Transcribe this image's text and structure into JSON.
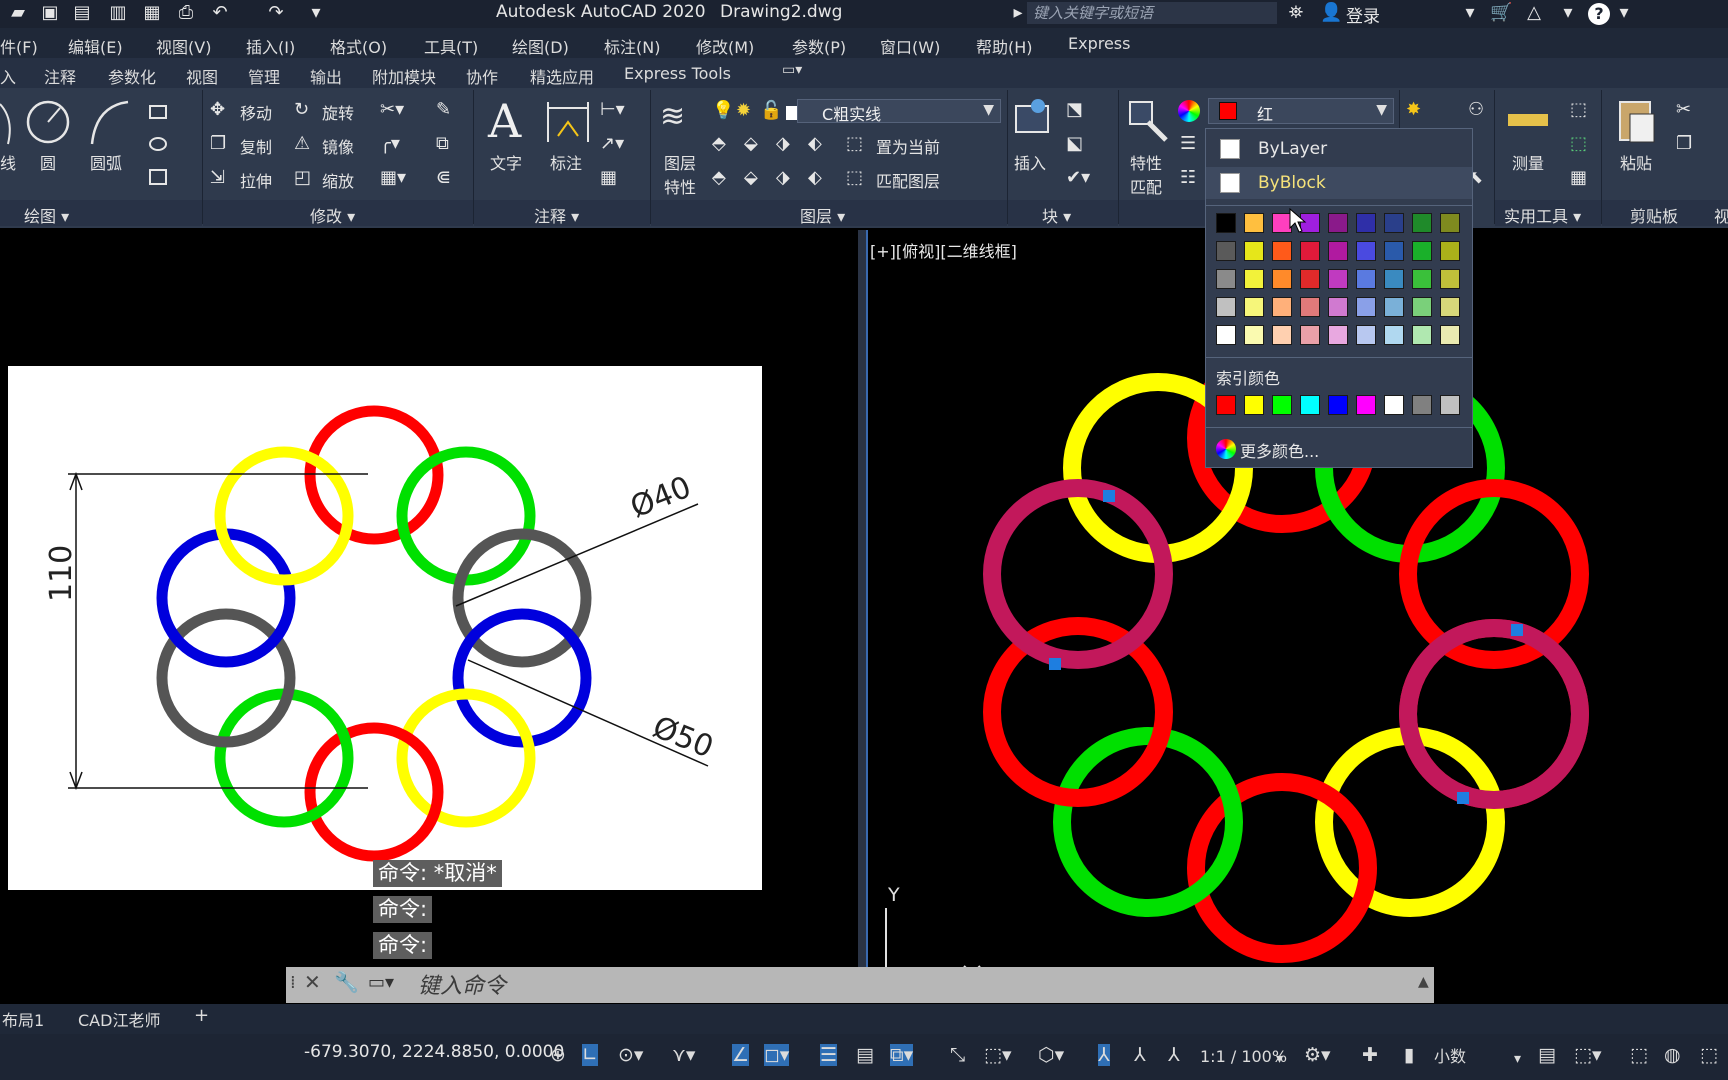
{
  "titlebar": {
    "app_title": "Autodesk AutoCAD 2020",
    "file_name": "Drawing2.dwg",
    "search_placeholder": "键入关键字或短语",
    "login": "登录",
    "help": "?"
  },
  "menubar": [
    "件(F)",
    "编辑(E)",
    "视图(V)",
    "插入(I)",
    "格式(O)",
    "工具(T)",
    "绘图(D)",
    "标注(N)",
    "修改(M)",
    "参数(P)",
    "窗口(W)",
    "帮助(H)",
    "Express"
  ],
  "ribbon_tabs": [
    "入",
    "注释",
    "参数化",
    "视图",
    "管理",
    "输出",
    "附加模块",
    "协作",
    "精选应用",
    "Express Tools"
  ],
  "ribbon": {
    "draw": {
      "line": "线",
      "circle": "圆",
      "arc": "圆弧",
      "title": "绘图 ▾"
    },
    "modify": {
      "move": "移动",
      "rotate": "旋转",
      "copy": "复制",
      "mirror": "镜像",
      "stretch": "拉伸",
      "scale": "缩放",
      "title": "修改 ▾"
    },
    "annotation": {
      "text": "文字",
      "dimension": "标注",
      "title": "注释 ▾"
    },
    "layers": {
      "layer_props_1": "图层",
      "layer_props_2": "特性",
      "current_layer": "C粗实线",
      "make_current": "置为当前",
      "match_layer": "匹配图层",
      "title": "图层 ▾"
    },
    "block": {
      "insert": "插入",
      "title": "块 ▾"
    },
    "properties": {
      "match_1": "特性",
      "match_2": "匹配",
      "color_value": "红"
    },
    "utilities": {
      "measure": "测量",
      "title": "实用工具 ▾"
    },
    "clipboard": {
      "paste": "粘贴",
      "title": "剪贴板"
    },
    "view_cut": "视"
  },
  "color_menu": {
    "bylayer": "ByLayer",
    "byblock": "ByBlock",
    "index_title": "索引颜色",
    "more_colors": "更多颜色...",
    "grid": [
      [
        "#000000",
        "#ffbf3f",
        "#ff3fbf",
        "#9f1fdf",
        "#8a1a8a",
        "#2f2fa8",
        "#2a3f8a",
        "#1f8a2a",
        "#7f8a1f"
      ],
      [
        "#5a5a5a",
        "#e6e61a",
        "#ff5a1a",
        "#e01a3a",
        "#b01aa0",
        "#4a4ae0",
        "#2a5aaa",
        "#1ab02a",
        "#aab01a"
      ],
      [
        "#8a8a8a",
        "#f2f23a",
        "#ff8a2a",
        "#e02a2a",
        "#c03ac0",
        "#5a7ae0",
        "#3a8ac0",
        "#3ac03a",
        "#c0c03a"
      ],
      [
        "#c0c0c0",
        "#f6f67a",
        "#ffb07a",
        "#e07a7a",
        "#d07ad0",
        "#8aa0e8",
        "#7ab0d8",
        "#7ad07a",
        "#d8d87a"
      ],
      [
        "#ffffff",
        "#fafab0",
        "#ffd0b0",
        "#eaa0a8",
        "#e8a8e0",
        "#b8c8f0",
        "#b0d8f0",
        "#b0e8b0",
        "#eaeab0"
      ]
    ],
    "index_colors": [
      "#ff0000",
      "#ffff00",
      "#00ff00",
      "#00ffff",
      "#0000ff",
      "#ff00ff",
      "#ffffff",
      "#808080",
      "#c0c0c0"
    ]
  },
  "viewport_label": "[+][俯视][二维线框]",
  "reference": {
    "dim_vertical": "110",
    "dim_d40": "Ø40",
    "dim_d50": "Ø50"
  },
  "command_history": [
    "命令: *取消*",
    "命令:",
    "命令:"
  ],
  "command_input_placeholder": "键入命令",
  "ucs": {
    "y": "Y"
  },
  "layout_tabs": [
    "布局1",
    "CAD江老师",
    "+"
  ],
  "status": {
    "coords": "-679.3070, 2224.8850, 0.0000",
    "scale": "1:1 / 100%",
    "units": "小数"
  }
}
